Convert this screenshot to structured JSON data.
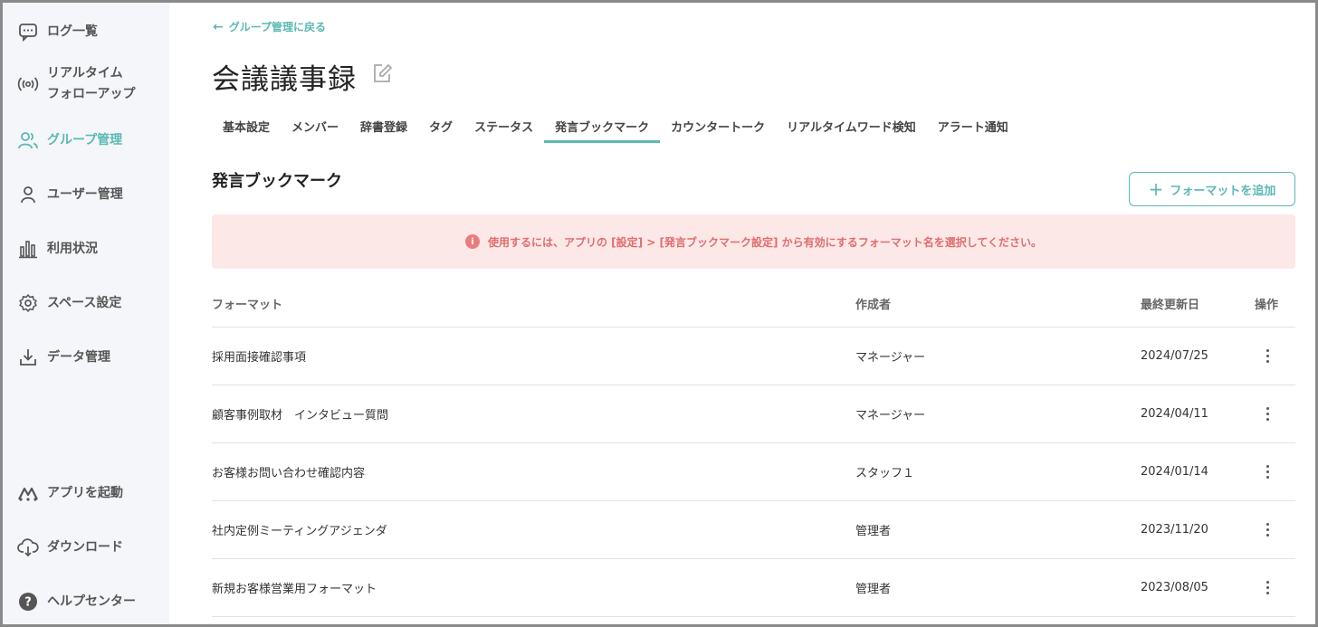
{
  "sidebar": {
    "items": [
      {
        "label": "ログ一覧",
        "icon": "chat-icon"
      },
      {
        "label": "リアルタイム\nフォローアップ",
        "icon": "broadcast-icon"
      },
      {
        "label": "グループ管理",
        "icon": "group-icon",
        "active": true
      },
      {
        "label": "ユーザー管理",
        "icon": "user-icon"
      },
      {
        "label": "利用状況",
        "icon": "bar-chart-icon"
      },
      {
        "label": "スペース設定",
        "icon": "gear-icon"
      },
      {
        "label": "データ管理",
        "icon": "download-icon"
      }
    ],
    "bottom_items": [
      {
        "label": "アプリを起動",
        "icon": "app-launch-icon"
      },
      {
        "label": "ダウンロード",
        "icon": "cloud-download-icon"
      },
      {
        "label": "ヘルプセンター",
        "icon": "help-icon"
      }
    ]
  },
  "header": {
    "back_label": "グループ管理に戻る",
    "title": "会議議事録"
  },
  "tabs": [
    {
      "label": "基本設定"
    },
    {
      "label": "メンバー"
    },
    {
      "label": "辞書登録"
    },
    {
      "label": "タグ"
    },
    {
      "label": "ステータス"
    },
    {
      "label": "発言ブックマーク",
      "active": true
    },
    {
      "label": "カウンタートーク"
    },
    {
      "label": "リアルタイムワード検知"
    },
    {
      "label": "アラート通知"
    }
  ],
  "section": {
    "title": "発言ブックマーク",
    "add_button": "フォーマットを追加",
    "alert": "使用するには、アプリの [設定] > [発言ブックマーク設定] から有効にするフォーマット名を選択してください。"
  },
  "table": {
    "headers": {
      "format": "フォーマット",
      "author": "作成者",
      "updated": "最終更新日",
      "actions": "操作"
    },
    "rows": [
      {
        "format": "採用面接確認事項",
        "author": "マネージャー",
        "updated": "2024/07/25"
      },
      {
        "format": "顧客事例取材　インタビュー質問",
        "author": "マネージャー",
        "updated": "2024/04/11"
      },
      {
        "format": "お客様お問い合わせ確認内容",
        "author": "スタッフ１",
        "updated": "2024/01/14"
      },
      {
        "format": "社内定例ミーティングアジェンダ",
        "author": "管理者",
        "updated": "2023/11/20"
      },
      {
        "format": "新規お客様営業用フォーマット",
        "author": "管理者",
        "updated": "2023/08/05"
      }
    ]
  },
  "colors": {
    "accent": "#5bb8b4",
    "alert_bg": "#fde8e8",
    "alert_text": "#e06d6d",
    "sidebar_bg": "#f5f6f9"
  }
}
